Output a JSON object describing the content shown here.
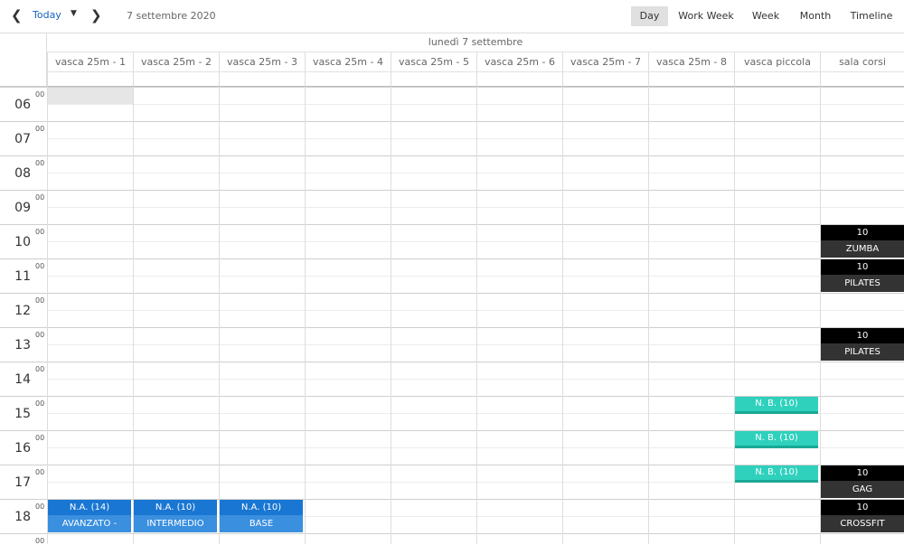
{
  "toolbar": {
    "prev_icon": "chevron-left-icon",
    "today_label": "Today",
    "caret_icon": "caret-down-icon",
    "next_icon": "chevron-right-icon",
    "current_date": "7 settembre 2020",
    "views": [
      {
        "label": "Day",
        "active": true
      },
      {
        "label": "Work Week",
        "active": false
      },
      {
        "label": "Week",
        "active": false
      },
      {
        "label": "Month",
        "active": false
      },
      {
        "label": "Timeline",
        "active": false
      }
    ]
  },
  "date_header": "lunedì 7 settembre",
  "resources": [
    "vasca 25m - 1",
    "vasca 25m - 2",
    "vasca 25m - 3",
    "vasca 25m - 4",
    "vasca 25m - 5",
    "vasca 25m - 6",
    "vasca 25m - 7",
    "vasca 25m - 8",
    "vasca piccola",
    "sala corsi"
  ],
  "hours": [
    "06",
    "07",
    "08",
    "09",
    "10",
    "11",
    "12",
    "13",
    "14",
    "15",
    "16",
    "17",
    "18"
  ],
  "minutes_label": "00",
  "colors": {
    "blue": "#1976d2",
    "teal": "#2fd1bd",
    "dark": "#000000"
  },
  "events": [
    {
      "resource": 9,
      "hour": "10",
      "count": "10",
      "title": "ZUMBA",
      "style": "dark"
    },
    {
      "resource": 9,
      "hour": "11",
      "count": "10",
      "title": "PILATES",
      "style": "dark"
    },
    {
      "resource": 9,
      "hour": "13",
      "count": "10",
      "title": "PILATES",
      "style": "dark"
    },
    {
      "resource": 9,
      "hour": "17",
      "count": "10",
      "title": "GAG",
      "style": "dark"
    },
    {
      "resource": 9,
      "hour": "18",
      "count": "10",
      "title": "CROSSFIT",
      "style": "dark"
    },
    {
      "resource": 8,
      "hour": "15",
      "title": "N. B. (10)",
      "style": "teal"
    },
    {
      "resource": 8,
      "hour": "16",
      "title": "N. B. (10)",
      "style": "teal"
    },
    {
      "resource": 8,
      "hour": "17",
      "title": "N. B. (10)",
      "style": "teal"
    },
    {
      "resource": 0,
      "hour": "18",
      "count": "N.A. (14)",
      "title": "AVANZATO - ROSSI MARCO",
      "style": "blue"
    },
    {
      "resource": 1,
      "hour": "18",
      "count": "N.A. (10)",
      "title": "INTERMEDIO",
      "style": "blue"
    },
    {
      "resource": 2,
      "hour": "18",
      "count": "N.A. (10)",
      "title": "BASE",
      "style": "blue"
    }
  ]
}
